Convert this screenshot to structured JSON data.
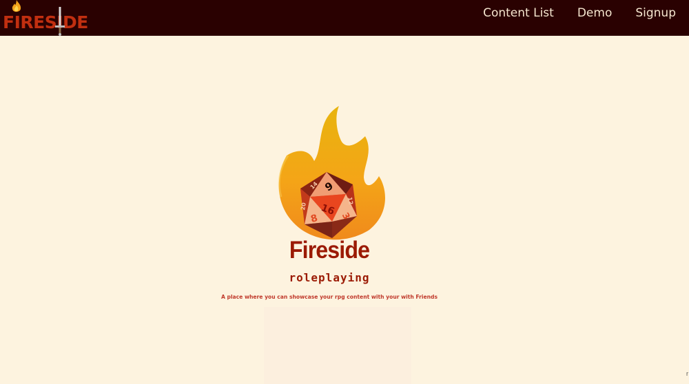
{
  "navbar": {
    "brand": "FIRESIDE",
    "links": [
      {
        "label": "Content List"
      },
      {
        "label": "Demo"
      },
      {
        "label": "Signup"
      }
    ]
  },
  "hero": {
    "title": "Fireside",
    "subtitle": "roleplaying",
    "tagline": "A place where you can showcase your rpg content with your with Friends",
    "die_numbers": [
      "9",
      "16",
      "8",
      "3",
      "14",
      "12",
      "20"
    ]
  },
  "corner_mark": "r"
}
